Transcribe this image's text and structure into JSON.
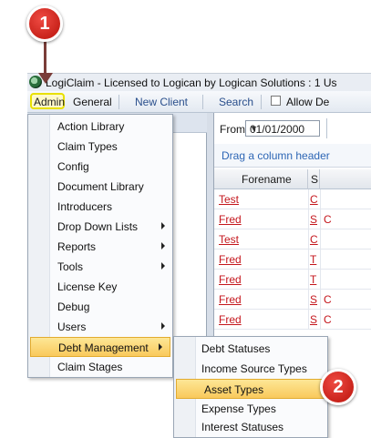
{
  "window": {
    "title": "LogiClaim - Licensed to Logican by Logican Solutions : 1 Us"
  },
  "menubar": {
    "admin": "Admin",
    "general": "General",
    "new_client": "New Client",
    "search": "Search",
    "allow_label": "Allow De"
  },
  "filter": {
    "from_label": "From",
    "from_value": "01/01/2000"
  },
  "grid": {
    "group_prompt": "Drag a column header",
    "columns": [
      "Forename",
      "S"
    ],
    "rows": [
      {
        "forename": "Test",
        "s": "C",
        "other": ""
      },
      {
        "forename": "Fred",
        "s": "S",
        "other": "C"
      },
      {
        "forename": "Test",
        "s": "C",
        "other": ""
      },
      {
        "forename": "Fred",
        "s": "T",
        "other": ""
      },
      {
        "forename": "Fred",
        "s": "T",
        "other": ""
      },
      {
        "forename": "Fred",
        "s": "S",
        "other": "C"
      },
      {
        "forename": "Fred",
        "s": "S",
        "other": "C"
      }
    ]
  },
  "admin_menu": {
    "items": [
      {
        "label": "Action Library",
        "has_submenu": false
      },
      {
        "label": "Claim Types",
        "has_submenu": false
      },
      {
        "label": "Config",
        "has_submenu": false
      },
      {
        "label": "Document Library",
        "has_submenu": false
      },
      {
        "label": "Introducers",
        "has_submenu": false
      },
      {
        "label": "Drop Down Lists",
        "has_submenu": true
      },
      {
        "label": "Reports",
        "has_submenu": true
      },
      {
        "label": "Tools",
        "has_submenu": true
      },
      {
        "label": "License Key",
        "has_submenu": false
      },
      {
        "label": "Debug",
        "has_submenu": false
      },
      {
        "label": "Users",
        "has_submenu": true
      },
      {
        "label": "Debt Management",
        "has_submenu": true
      },
      {
        "label": "Claim Stages",
        "has_submenu": false
      }
    ]
  },
  "debt_submenu": {
    "items": [
      {
        "label": "Debt Statuses"
      },
      {
        "label": "Income Source Types"
      },
      {
        "label": "Asset Types"
      },
      {
        "label": "Expense Types"
      },
      {
        "label": "Interest Statuses"
      }
    ]
  },
  "callouts": {
    "step1": "1",
    "step2": "2"
  },
  "colors": {
    "highlight": "#f9c95c",
    "callout": "#c9231b",
    "link_red": "#c4161c",
    "admin_outline": "#e8e000"
  }
}
